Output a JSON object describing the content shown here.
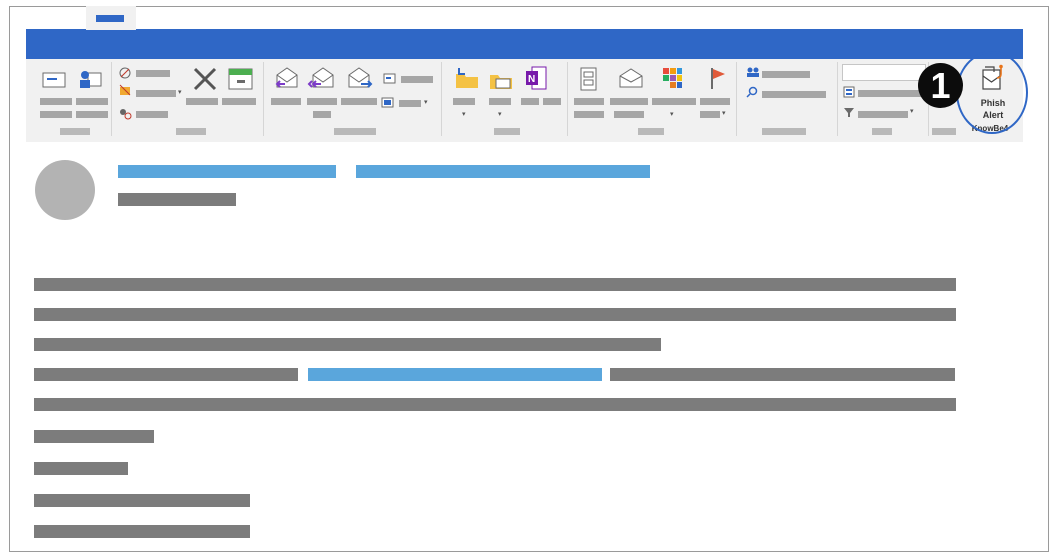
{
  "addin": {
    "button_line1": "Phish",
    "button_line2": "Alert",
    "group_label": "KnowBe4"
  },
  "step_badge": "1",
  "icons": {
    "phish_alert": "phish-alert-icon",
    "delete": "delete-x-icon",
    "reply": "reply-icon",
    "reply_all": "reply-all-icon",
    "forward": "forward-icon",
    "onenote": "onenote-icon",
    "flag": "flag-icon"
  },
  "colors": {
    "tab_bar": "#2f67c6",
    "ribbon": "#f1f1f1",
    "link_placeholder": "#5aa6dc",
    "text_placeholder": "#7c7c7c",
    "onenote": "#7719aa",
    "flag": "#e05a3a"
  }
}
